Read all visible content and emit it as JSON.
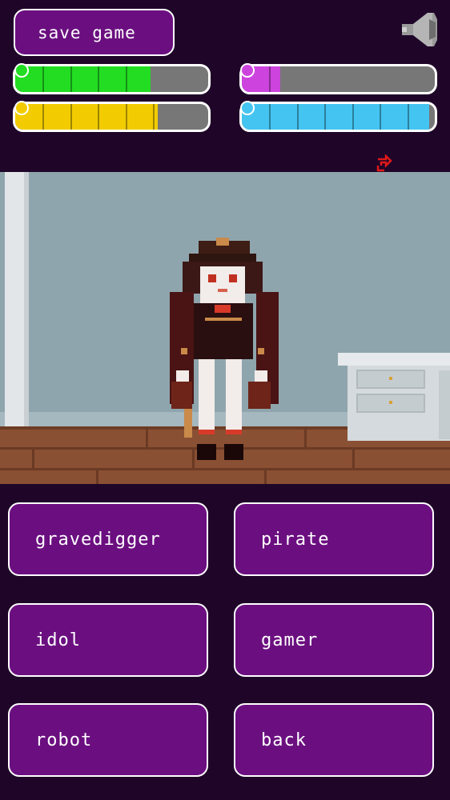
{
  "header": {
    "save_label": "save game",
    "sound_icon": "speaker-icon"
  },
  "stats": [
    {
      "name": "green",
      "color": "#22dd22",
      "value": 0.7,
      "icon": "smiley-icon"
    },
    {
      "name": "magenta",
      "color": "#cc44dd",
      "value": 0.2,
      "icon": "heart-icon"
    },
    {
      "name": "yellow",
      "color": "#f2cc00",
      "value": 0.74,
      "icon": "food-icon"
    },
    {
      "name": "blue",
      "color": "#44c4f0",
      "value": 0.97,
      "icon": "drop-icon"
    }
  ],
  "refresh_icon": "refresh-icon",
  "choices": {
    "gravedigger": "gravedigger",
    "pirate": "pirate",
    "idol": "idol",
    "gamer": "gamer",
    "robot": "robot",
    "back": "back"
  },
  "colors": {
    "background": "#1f0629",
    "button": "#6b0f80",
    "wall": "#8fa5ad",
    "floor": "#8a5033"
  }
}
